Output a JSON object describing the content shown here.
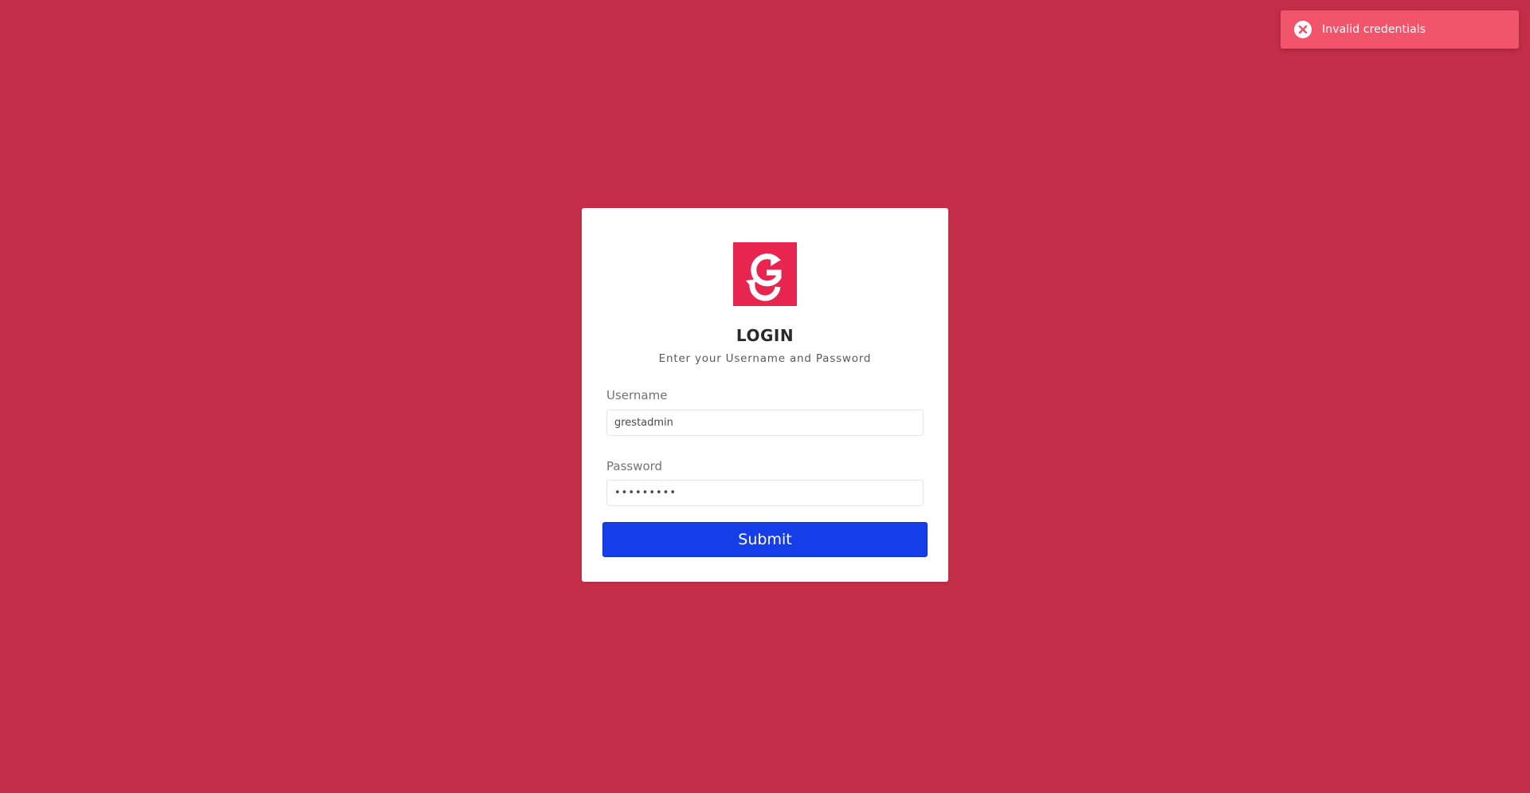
{
  "toast": {
    "icon": "close-circle-icon",
    "message": "Invalid credentials",
    "color": "#f2546c"
  },
  "login": {
    "logo_icon": "brand-logo-g-icon",
    "logo_color": "#e8254f",
    "title": "LOGIN",
    "subtitle": "Enter your Username and Password",
    "username_label": "Username",
    "username_value": "grestadmin",
    "password_label": "Password",
    "password_value": "•••••••••",
    "submit_label": "Submit",
    "submit_color": "#153ee8"
  },
  "background_color": "#c52e48"
}
